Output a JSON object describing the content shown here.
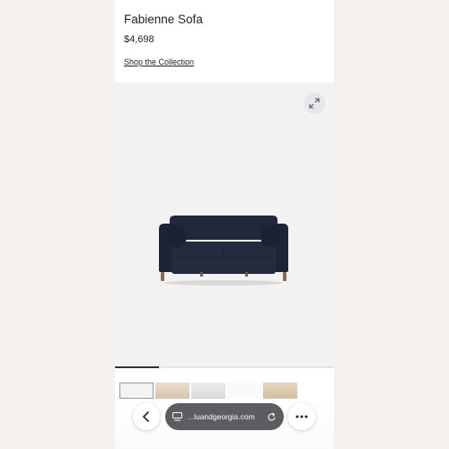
{
  "product": {
    "name": "Fabienne Sofa",
    "price": "$4,698",
    "shop_link": "Shop the Collection"
  },
  "gallery": {
    "current_image": "navy-sofa",
    "progress_fraction": 0.2,
    "thumbnails": [
      "navy-sofa",
      "beige-sofa-room",
      "grey-sofa-room",
      "white-image",
      "tan-sofa-room"
    ]
  },
  "browser": {
    "url": "luluandgeorgia.com",
    "url_display": "...luandgeorgia.com",
    "icons": [
      "back-icon",
      "tabs-icon",
      "reload-icon",
      "more-icon"
    ]
  },
  "colors": {
    "page_bg": "#f5f1ee",
    "sofa_fabric": "#1f2538",
    "url_pill": "#5b5d60"
  }
}
